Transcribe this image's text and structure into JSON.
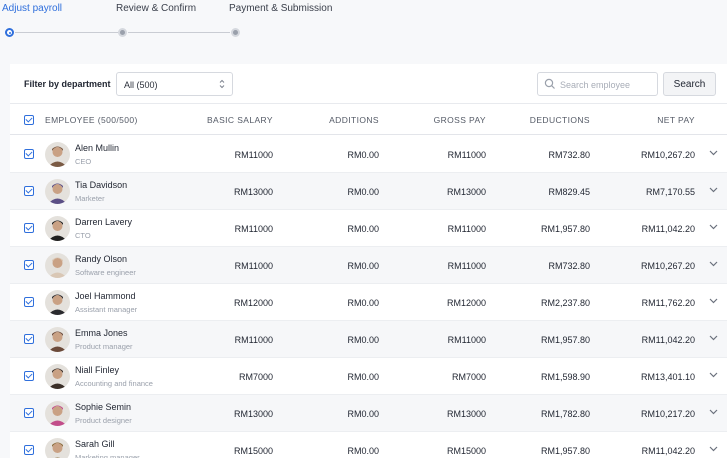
{
  "steps": [
    {
      "label": "Adjust payroll",
      "active": true
    },
    {
      "label": "Review & Confirm",
      "active": false
    },
    {
      "label": "Payment & Submission",
      "active": false
    }
  ],
  "filter": {
    "label": "Filter by department",
    "department_value": "All (500)"
  },
  "search": {
    "placeholder": "Search employee",
    "value": "",
    "button_label": "Search"
  },
  "table": {
    "columns": {
      "employee": "EMPLOYEE (500/500)",
      "basic_salary": "BASIC SALARY",
      "additions": "ADDITIONS",
      "gross_pay": "GROSS PAY",
      "deductions": "DEDUCTIONS",
      "net_pay": "NET PAY"
    },
    "rows": [
      {
        "name": "Alen Mullin",
        "role": "CEO",
        "basic_salary": "RM11000",
        "additions": "RM0.00",
        "gross_pay": "RM11000",
        "deductions": "RM732.80",
        "net_pay": "RM10,267.20",
        "avatar_color": "#7a5a44"
      },
      {
        "name": "Tia Davidson",
        "role": "Marketer",
        "basic_salary": "RM13000",
        "additions": "RM0.00",
        "gross_pay": "RM13000",
        "deductions": "RM829.45",
        "net_pay": "RM7,170.55",
        "avatar_color": "#5b4f86"
      },
      {
        "name": "Darren Lavery",
        "role": "CTO",
        "basic_salary": "RM11000",
        "additions": "RM0.00",
        "gross_pay": "RM11000",
        "deductions": "RM1,957.80",
        "net_pay": "RM11,042.20",
        "avatar_color": "#1f1f1f"
      },
      {
        "name": "Randy Olson",
        "role": "Software engineer",
        "basic_salary": "RM11000",
        "additions": "RM0.00",
        "gross_pay": "RM11000",
        "deductions": "RM732.80",
        "net_pay": "RM10,267.20",
        "avatar_color": "#d9c7b5"
      },
      {
        "name": "Joel Hammond",
        "role": "Assistant manager",
        "basic_salary": "RM12000",
        "additions": "RM0.00",
        "gross_pay": "RM12000",
        "deductions": "RM2,237.80",
        "net_pay": "RM11,762.20",
        "avatar_color": "#2a2a2e"
      },
      {
        "name": "Emma Jones",
        "role": "Product manager",
        "basic_salary": "RM11000",
        "additions": "RM0.00",
        "gross_pay": "RM11000",
        "deductions": "RM1,957.80",
        "net_pay": "RM11,042.20",
        "avatar_color": "#6b4a3a"
      },
      {
        "name": "Niall Finley",
        "role": "Accounting and finance",
        "basic_salary": "RM7000",
        "additions": "RM0.00",
        "gross_pay": "RM7000",
        "deductions": "RM1,598.90",
        "net_pay": "RM13,401.10",
        "avatar_color": "#3b2f28"
      },
      {
        "name": "Sophie Semin",
        "role": "Product designer",
        "basic_salary": "RM13000",
        "additions": "RM0.00",
        "gross_pay": "RM13000",
        "deductions": "RM1,782.80",
        "net_pay": "RM10,217.20",
        "avatar_color": "#c24d8a"
      },
      {
        "name": "Sarah Gill",
        "role": "Marketing manager",
        "basic_salary": "RM15000",
        "additions": "RM0.00",
        "gross_pay": "RM15000",
        "deductions": "RM1,957.80",
        "net_pay": "RM11,042.20",
        "avatar_color": "#8a6a3a"
      }
    ]
  },
  "colors": {
    "accent": "#2f6fdc",
    "row_alt": "#f6f7f9"
  }
}
